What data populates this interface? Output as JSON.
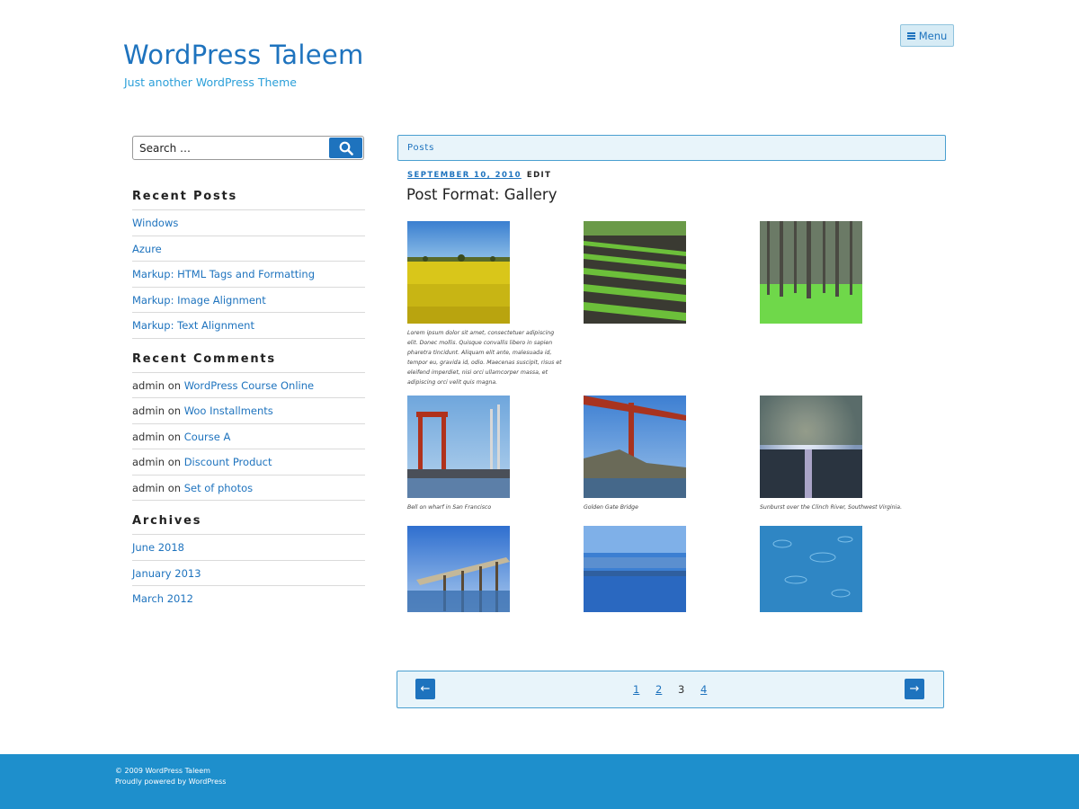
{
  "site": {
    "title": "WordPress Taleem",
    "description": "Just another WordPress Theme"
  },
  "header": {
    "menu_label": "Menu"
  },
  "search": {
    "placeholder": "Search …"
  },
  "sidebar": {
    "recent_posts": {
      "title": "Recent Posts",
      "items": [
        "Windows",
        "Azure",
        "Markup: HTML Tags and Formatting",
        "Markup: Image Alignment",
        "Markup: Text Alignment"
      ]
    },
    "recent_comments": {
      "title": "Recent Comments",
      "items": [
        {
          "author": "admin",
          "on": "on",
          "post": "WordPress Course Online"
        },
        {
          "author": "admin",
          "on": "on",
          "post": "Woo Installments"
        },
        {
          "author": "admin",
          "on": "on",
          "post": "Course A"
        },
        {
          "author": "admin",
          "on": "on",
          "post": "Discount Product"
        },
        {
          "author": "admin",
          "on": "on",
          "post": "Set of photos"
        }
      ]
    },
    "archives": {
      "title": "Archives",
      "items": [
        "June 2018",
        "January 2013",
        "March 2012"
      ]
    }
  },
  "main": {
    "section_label": "Posts",
    "post": {
      "date": "SEPTEMBER 10, 2010",
      "edit": "EDIT",
      "title": "Post Format: Gallery"
    },
    "gallery": {
      "captions": [
        "Lorem ipsum dolor sit amet, consectetuer adipiscing elit. Donec mollis. Quisque convallis libero in sapien pharetra tincidunt. Aliquam elit ante, malesuada id, tempor eu, gravida id, odio. Maecenas suscipit, risus et eleifend imperdiet, nisi orci ullamcorper massa, et adipiscing orci velit quis magna.",
        "Bell on wharf in San Francisco",
        "Golden Gate Bridge",
        "Sunburst over the Clinch River, Southwest Virginia."
      ]
    },
    "pagination": {
      "prev": "←",
      "next": "→",
      "pages": [
        "1",
        "2",
        "3",
        "4"
      ],
      "current": "3"
    }
  },
  "footer": {
    "copyright": "© 2009 WordPress Taleem",
    "powered": "Proudly powered by WordPress"
  },
  "colors": {
    "accent": "#1e73be",
    "footer_bg": "#1e8fcc",
    "panel_bg": "#e8f4fa"
  }
}
